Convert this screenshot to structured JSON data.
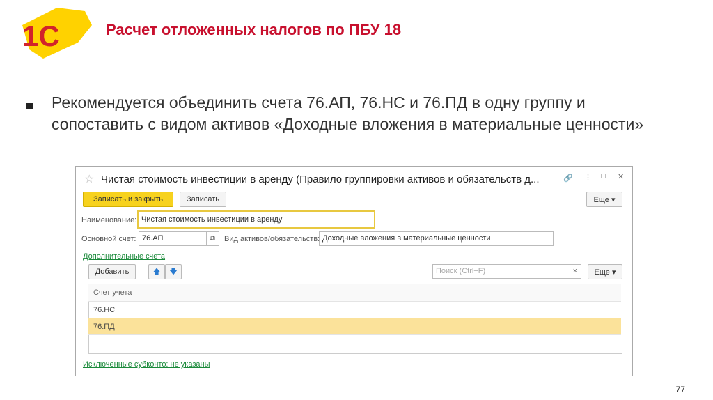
{
  "logo": {
    "text": "1С"
  },
  "slide": {
    "title": "Расчет отложенных налогов по ПБУ 18",
    "bullet": "Рекомендуется объединить счета 76.АП, 76.НС и 76.ПД в одну группу и сопоставить с видом активов «Доходные вложения в материальные ценности»",
    "page": "77"
  },
  "window": {
    "title": "Чистая стоимость инвестиции в аренду (Правило группировки активов и обязательств д...",
    "save_close": "Записать и закрыть",
    "save": "Записать",
    "more": "Еще ▾",
    "name_label": "Наименование:",
    "name_value": "Чистая стоимость инвестиции в аренду",
    "account_label": "Основной счет:",
    "account_value": "76.АП",
    "kind_label": "Вид активов/обязательств:",
    "kind_value": "Доходные вложения в материальные ценности",
    "extra_link": "Дополнительные счета",
    "add": "Добавить",
    "search_placeholder": "Поиск (Ctrl+F)",
    "more2": "Еще ▾",
    "col_header": "Счет учета",
    "rows": [
      "76.НС",
      "76.ПД"
    ],
    "excluded_link": "Исключенные субконто:  не указаны"
  }
}
